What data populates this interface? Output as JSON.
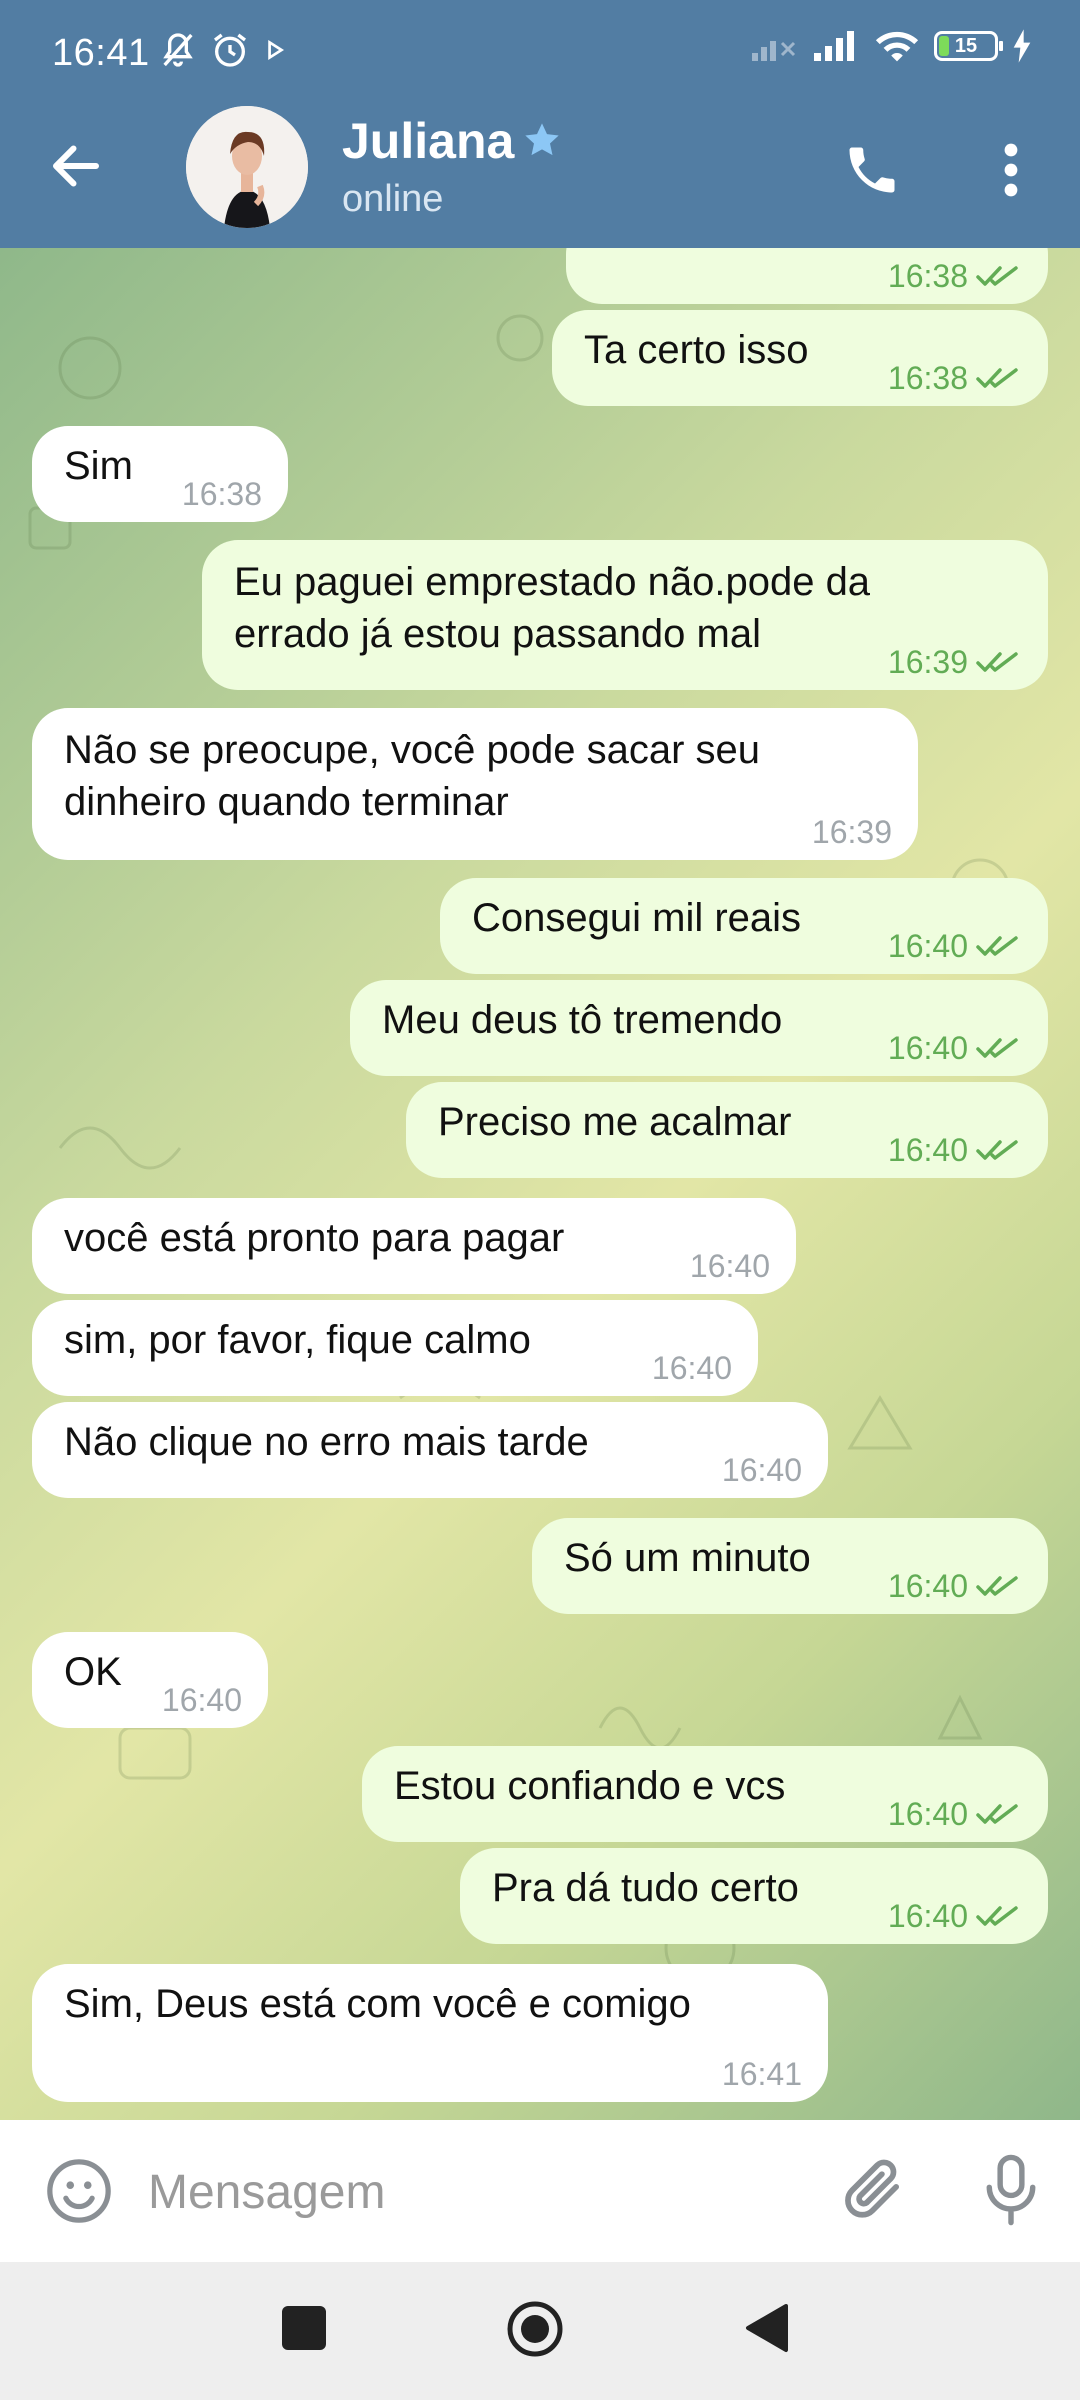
{
  "status_bar": {
    "time": "16:41",
    "battery": "15",
    "icons": [
      "notifications-off-icon",
      "alarm-icon",
      "play-icon",
      "signal-off-icon",
      "signal-icon",
      "wifi-icon",
      "battery-icon",
      "charging-icon"
    ]
  },
  "header": {
    "name": "Juliana",
    "status": "online",
    "colors": {
      "bar": "#527da3",
      "star": "#8cc7f5"
    }
  },
  "messages": [
    {
      "dir": "out",
      "text": "",
      "time": "16:38",
      "read": true
    },
    {
      "dir": "out",
      "text": "Ta certo isso",
      "time": "16:38",
      "read": true
    },
    {
      "dir": "in",
      "text": "Sim",
      "time": "16:38"
    },
    {
      "dir": "out",
      "text": "Eu paguei emprestado não.pode da\nerrado já estou passando mal",
      "time": "16:39",
      "read": true
    },
    {
      "dir": "in",
      "text": "Não se preocupe, você pode sacar seu\ndinheiro quando terminar",
      "time": "16:39"
    },
    {
      "dir": "out",
      "text": "Consegui mil reais",
      "time": "16:40",
      "read": true
    },
    {
      "dir": "out",
      "text": "Meu deus tô tremendo",
      "time": "16:40",
      "read": true
    },
    {
      "dir": "out",
      "text": "Preciso me acalmar",
      "time": "16:40",
      "read": true
    },
    {
      "dir": "in",
      "text": "você está pronto para pagar",
      "time": "16:40"
    },
    {
      "dir": "in",
      "text": "sim, por favor, fique calmo",
      "time": "16:40"
    },
    {
      "dir": "in",
      "text": "Não clique no erro mais tarde",
      "time": "16:40"
    },
    {
      "dir": "out",
      "text": "Só um minuto",
      "time": "16:40",
      "read": true
    },
    {
      "dir": "in",
      "text": "OK",
      "time": "16:40"
    },
    {
      "dir": "out",
      "text": "Estou confiando e vcs",
      "time": "16:40",
      "read": true
    },
    {
      "dir": "out",
      "text": "Pra dá tudo certo",
      "time": "16:40",
      "read": true
    },
    {
      "dir": "in",
      "text": "Sim, Deus está com você e comigo",
      "time": "16:41"
    }
  ],
  "input": {
    "placeholder": "Mensagem"
  },
  "colors": {
    "outgoing_bubble": "#effdde",
    "incoming_bubble": "#ffffff",
    "read_ticks": "#62ac55"
  }
}
